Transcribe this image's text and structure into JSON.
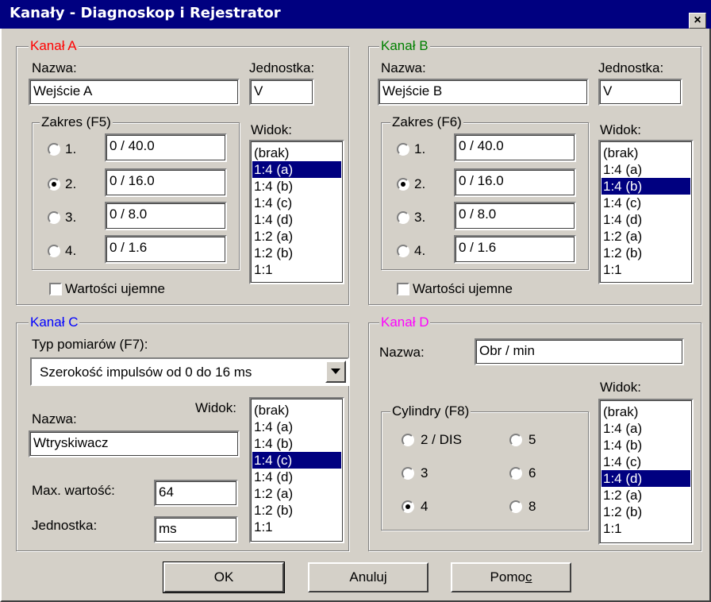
{
  "window": {
    "title": "Kanały - Diagnoskop i Rejestrator",
    "close_label": "×"
  },
  "colors": {
    "kanal_a": "#ff0000",
    "kanal_b": "#008000",
    "kanal_c": "#0000ff",
    "kanal_d": "#ff00ff",
    "selection": "#000080"
  },
  "kanal_a": {
    "legend": "Kanał A",
    "name_label": "Nazwa:",
    "name_value": "Wejście A",
    "unit_label": "Jednostka:",
    "unit_value": "V",
    "range_legend": "Zakres (F5)",
    "ranges": [
      {
        "label": "1.",
        "value": "0 / 40.0"
      },
      {
        "label": "2.",
        "value": "0 / 16.0"
      },
      {
        "label": "3.",
        "value": "0 / 8.0"
      },
      {
        "label": "4.",
        "value": "0 / 1.6"
      }
    ],
    "selected_range": 2,
    "view_label": "Widok:",
    "view_items": [
      "(brak)",
      "1:4 (a)",
      "1:4 (b)",
      "1:4 (c)",
      "1:4 (d)",
      "1:2 (a)",
      "1:2 (b)",
      "1:1"
    ],
    "view_selected": "1:4 (a)",
    "negative_label": "Wartości ujemne",
    "negative_checked": false
  },
  "kanal_b": {
    "legend": "Kanał B",
    "name_label": "Nazwa:",
    "name_value": "Wejście B",
    "unit_label": "Jednostka:",
    "unit_value": "V",
    "range_legend": "Zakres (F6)",
    "ranges": [
      {
        "label": "1.",
        "value": "0 / 40.0"
      },
      {
        "label": "2.",
        "value": "0 / 16.0"
      },
      {
        "label": "3.",
        "value": "0 / 8.0"
      },
      {
        "label": "4.",
        "value": "0 / 1.6"
      }
    ],
    "selected_range": 2,
    "view_label": "Widok:",
    "view_items": [
      "(brak)",
      "1:4 (a)",
      "1:4 (b)",
      "1:4 (c)",
      "1:4 (d)",
      "1:2 (a)",
      "1:2 (b)",
      "1:1"
    ],
    "view_selected": "1:4 (b)",
    "negative_label": "Wartości ujemne",
    "negative_checked": false
  },
  "kanal_c": {
    "legend": "Kanał C",
    "type_label": "Typ pomiarów (F7):",
    "type_value": "Szerokość impulsów od 0 do 16 ms",
    "view_label": "Widok:",
    "name_label": "Nazwa:",
    "name_value": "Wtryskiwacz",
    "max_label": "Max. wartość:",
    "max_value": "64",
    "unit_label": "Jednostka:",
    "unit_value": "ms",
    "view_items": [
      "(brak)",
      "1:4 (a)",
      "1:4 (b)",
      "1:4 (c)",
      "1:4 (d)",
      "1:2 (a)",
      "1:2 (b)",
      "1:1"
    ],
    "view_selected": "1:4 (c)"
  },
  "kanal_d": {
    "legend": "Kanał D",
    "name_label": "Nazwa:",
    "name_value": "Obr / min",
    "view_label": "Widok:",
    "cyl_legend": "Cylindry (F8)",
    "cylinders": [
      "2 / DIS",
      "5",
      "3",
      "6",
      "4",
      "8"
    ],
    "cyl_selected": "4",
    "view_items": [
      "(brak)",
      "1:4 (a)",
      "1:4 (b)",
      "1:4 (c)",
      "1:4 (d)",
      "1:2 (a)",
      "1:2 (b)",
      "1:1"
    ],
    "view_selected": "1:4 (d)"
  },
  "buttons": {
    "ok": "OK",
    "cancel": "Anuluj",
    "help_prefix": "Pomo",
    "help_accel": "c"
  }
}
